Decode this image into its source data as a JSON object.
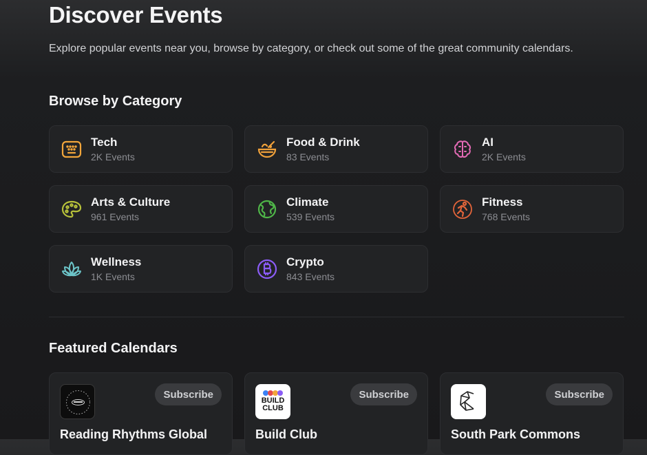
{
  "header": {
    "title": "Discover Events",
    "subtitle": "Explore popular events near you, browse by category, or check out some of the great community calendars."
  },
  "categories_section": {
    "title": "Browse by Category",
    "items": [
      {
        "name": "Tech",
        "count": "2K Events",
        "icon": "keyboard-icon",
        "color": "#f2a63b"
      },
      {
        "name": "Food & Drink",
        "count": "83 Events",
        "icon": "food-bowl-icon",
        "color": "#f0a13a"
      },
      {
        "name": "AI",
        "count": "2K Events",
        "icon": "brain-icon",
        "color": "#e46bb5"
      },
      {
        "name": "Arts & Culture",
        "count": "961 Events",
        "icon": "palette-icon",
        "color": "#b8c23a"
      },
      {
        "name": "Climate",
        "count": "539 Events",
        "icon": "globe-icon",
        "color": "#4fb548"
      },
      {
        "name": "Fitness",
        "count": "768 Events",
        "icon": "running-person-icon",
        "color": "#e2643a"
      },
      {
        "name": "Wellness",
        "count": "1K Events",
        "icon": "lotus-icon",
        "color": "#6cc4c8"
      },
      {
        "name": "Crypto",
        "count": "843 Events",
        "icon": "bitcoin-icon",
        "color": "#8b5cf6"
      }
    ]
  },
  "calendars_section": {
    "title": "Featured Calendars",
    "items": [
      {
        "name": "Reading Rhythms Global",
        "button": "Subscribe",
        "logo": "reading-rhythms-logo"
      },
      {
        "name": "Build Club",
        "button": "Subscribe",
        "logo": "build-club-logo",
        "logo_text": "BUILD CLUB"
      },
      {
        "name": "South Park Commons",
        "button": "Subscribe",
        "logo": "south-park-commons-logo"
      }
    ]
  }
}
